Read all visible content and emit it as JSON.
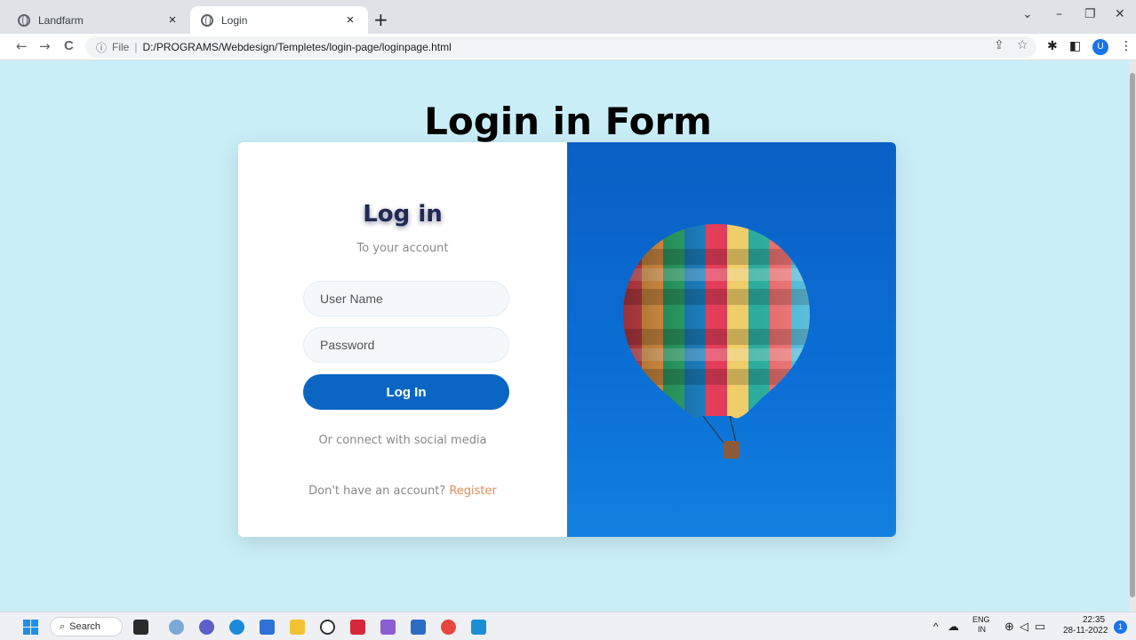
{
  "browser": {
    "tabs": [
      {
        "title": "Landfarm",
        "close": "×"
      },
      {
        "title": "Login",
        "close": "×"
      }
    ],
    "new_tab": "+",
    "window_controls": {
      "dropdown": "⌄",
      "minimize": "–",
      "restore": "❐",
      "close": "✕"
    },
    "address": {
      "info": "ⓘ",
      "scheme": "File",
      "separator": "|",
      "url": "D:/PROGRAMS/Webdesign/Templetes/login-page/loginpage.html"
    },
    "nav": {
      "back": "←",
      "forward": "→",
      "reload": "C"
    },
    "profile_initial": "U"
  },
  "page": {
    "title": "Login in Form",
    "login": {
      "heading": "Log in",
      "subheading": "To your account",
      "username_placeholder": "User Name",
      "password_placeholder": "Password",
      "button": "Log In",
      "social_text": "Or connect with social media",
      "signup_prompt": "Don't have an account?",
      "register_link": "Register"
    }
  },
  "taskbar": {
    "search_label": "Search",
    "tray": {
      "language": "ENG",
      "region": "IN",
      "time": "22:35",
      "date": "28-11-2022",
      "notifications": "1"
    }
  },
  "colors": {
    "page_background": "#c9eef7",
    "button": "#0b66c3",
    "register_link": "#e58b5a",
    "image_sky": "#0b6fd6"
  }
}
